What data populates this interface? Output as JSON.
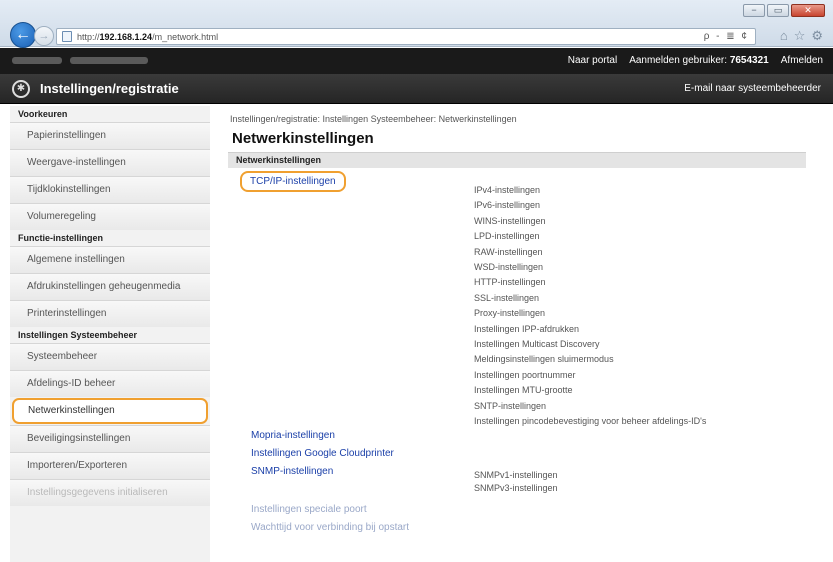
{
  "browser": {
    "url_prefix": "http://",
    "url_host": "192.168.1.24",
    "url_path": "/m_network.html",
    "addr_right": "ρ - ≣ ¢",
    "win_min": "−",
    "win_max": "▭",
    "win_close": "✕"
  },
  "topbar": {
    "portal": "Naar portal",
    "user_label": "Aanmelden gebruiker:",
    "user_value": "7654321",
    "logout": "Afmelden"
  },
  "header": {
    "title": "Instellingen/registratie",
    "mail": "E-mail naar systeembeheerder"
  },
  "sidebar": {
    "items": [
      {
        "type": "section",
        "label": "Voorkeuren"
      },
      {
        "type": "item",
        "label": "Papierinstellingen"
      },
      {
        "type": "item",
        "label": "Weergave-instellingen"
      },
      {
        "type": "item",
        "label": "Tijdklokinstellingen"
      },
      {
        "type": "item",
        "label": "Volumeregeling"
      },
      {
        "type": "section",
        "label": "Functie-instellingen"
      },
      {
        "type": "item",
        "label": "Algemene instellingen"
      },
      {
        "type": "item",
        "label": "Afdrukinstellingen geheugenmedia"
      },
      {
        "type": "item",
        "label": "Printerinstellingen"
      },
      {
        "type": "section",
        "label": "Instellingen Systeembeheer"
      },
      {
        "type": "item",
        "label": "Systeembeheer"
      },
      {
        "type": "item",
        "label": "Afdelings-ID beheer"
      },
      {
        "type": "item",
        "label": "Netwerkinstellingen",
        "highlight": true
      },
      {
        "type": "item",
        "label": "Beveiligingsinstellingen"
      },
      {
        "type": "item",
        "label": "Importeren/Exporteren"
      },
      {
        "type": "item",
        "label": "Instellingsgegevens initialiseren",
        "dim": true
      }
    ]
  },
  "main": {
    "breadcrumb": "Instellingen/registratie: Instellingen Systeembeheer: Netwerkinstellingen",
    "title": "Netwerkinstellingen",
    "section": "Netwerkinstellingen",
    "tcpip_link": "TCP/IP-instellingen",
    "tcpip_subs": [
      "IPv4-instellingen",
      "IPv6-instellingen",
      "WINS-instellingen",
      "LPD-instellingen",
      "RAW-instellingen",
      "WSD-instellingen",
      "HTTP-instellingen",
      "SSL-instellingen",
      "Proxy-instellingen",
      "Instellingen IPP-afdrukken",
      "Instellingen Multicast Discovery",
      "Meldingsinstellingen sluimermodus",
      "Instellingen poortnummer",
      "Instellingen MTU-grootte",
      "SNTP-instellingen",
      "Instellingen pincodebevestiging voor beheer afdelings-ID's"
    ],
    "mopria_link": "Mopria-instellingen",
    "google_link": "Instellingen Google Cloudprinter",
    "snmp_link": "SNMP-instellingen",
    "snmp_subs": [
      "SNMPv1-instellingen",
      "SNMPv3-instellingen"
    ],
    "port_link": "Instellingen speciale poort",
    "wait_link": "Wachttijd voor verbinding bij opstart"
  }
}
